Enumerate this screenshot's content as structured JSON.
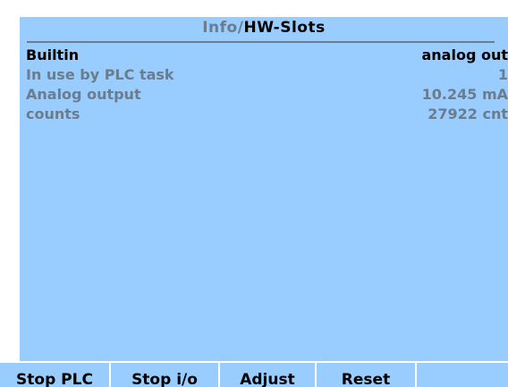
{
  "header": {
    "breadcrumb_parent": "Info",
    "separator": "/",
    "current": "HW-Slots"
  },
  "info_rows": [
    {
      "label": "Builtin",
      "value": "analog out"
    },
    {
      "label": "In use by PLC task",
      "value": "1"
    },
    {
      "label": "Analog output",
      "value": "10.245 mA"
    },
    {
      "label": "counts",
      "value": "27922 cnt"
    }
  ],
  "softkeys": [
    {
      "label": "Stop PLC"
    },
    {
      "label": "Stop i/o"
    },
    {
      "label": "Adjust"
    },
    {
      "label": "Reset"
    },
    {
      "label": ""
    }
  ],
  "colors": {
    "panel_background": "#99ccff",
    "primary_text": "#000000",
    "secondary_text": "#6b7c8d",
    "frame": "#ffffff"
  }
}
